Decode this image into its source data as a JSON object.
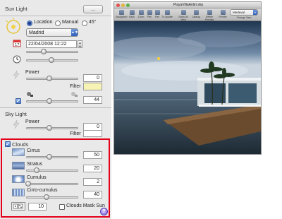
{
  "sun_light": {
    "title": "Sun Light",
    "top_button": "...",
    "mode_location": "Location",
    "mode_manual": "Manual",
    "mode_45": "45°",
    "city": "Madrid",
    "date_time": "22/04/2008 12:22",
    "power_label": "Power",
    "power_value": "0",
    "filter_label": "Filter",
    "filter_color": "#f6f3b4",
    "softness_value": "44"
  },
  "sky_light": {
    "title": "Sky Light",
    "power_label": "Power",
    "power_value": "0",
    "filter_label": "Filter",
    "filter_color": "#ffffff"
  },
  "clouds": {
    "title": "Clouds",
    "enabled": true,
    "layers": [
      {
        "name": "Cirrus",
        "value": "50"
      },
      {
        "name": "Stratus",
        "value": "20"
      },
      {
        "name": "Cumulus",
        "value": "2"
      },
      {
        "name": "Cirro-cumulus",
        "value": "40"
      }
    ],
    "seed_value": "10",
    "mask_sun_label": "Clouds Mask Sun",
    "help": "?"
  },
  "render_window": {
    "title": "PlayaVillaAntiri.skp",
    "view_select": "Medeval",
    "toolbar": [
      "Navigation",
      "Back",
      "Zoom",
      "Pan",
      "Pan",
      "To Update",
      "Show All View",
      "Catalog",
      "Refine Preview",
      "Render",
      "Change View"
    ]
  },
  "colors": {
    "highlight": "#e3001b",
    "accent": "#3a66b0"
  }
}
